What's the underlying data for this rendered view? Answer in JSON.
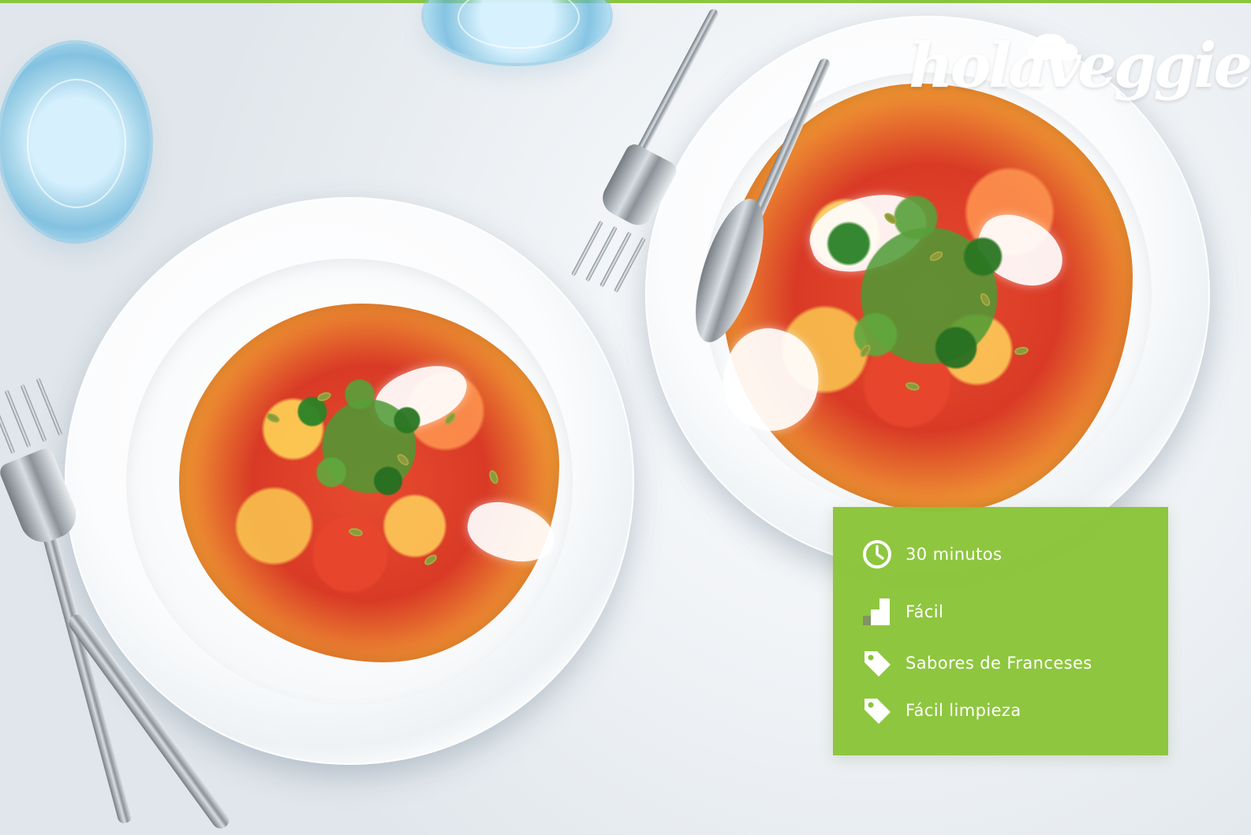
{
  "brand": {
    "name": "holaveggie"
  },
  "recipe_info": {
    "time": "30 minutos",
    "difficulty": "Fácil",
    "difficulty_level": 2,
    "tags": [
      "Sabores de Franceses",
      "Fácil limpieza"
    ]
  },
  "icons": {
    "time": "clock-icon",
    "difficulty": "difficulty-icon",
    "tag": "tag-icon"
  },
  "colors": {
    "accent": "#8cc63f",
    "card": "#8ac439",
    "text": "#ffffff"
  }
}
